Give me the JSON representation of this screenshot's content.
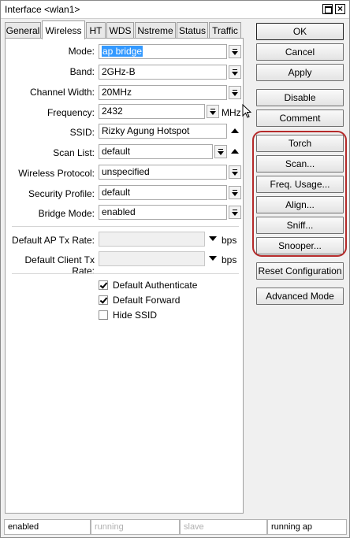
{
  "window": {
    "title": "Interface <wlan1>"
  },
  "tabs": [
    {
      "label": "General"
    },
    {
      "label": "Wireless"
    },
    {
      "label": "HT"
    },
    {
      "label": "WDS"
    },
    {
      "label": "Nstreme"
    },
    {
      "label": "Status"
    },
    {
      "label": "Traffic"
    }
  ],
  "active_tab": "Wireless",
  "form": {
    "mode": {
      "label": "Mode:",
      "value": "ap bridge"
    },
    "band": {
      "label": "Band:",
      "value": "2GHz-B"
    },
    "channel_width": {
      "label": "Channel Width:",
      "value": "20MHz"
    },
    "frequency": {
      "label": "Frequency:",
      "value": "2432",
      "unit": "MHz"
    },
    "ssid": {
      "label": "SSID:",
      "value": "Rizky Agung Hotspot"
    },
    "scan_list": {
      "label": "Scan List:",
      "value": "default"
    },
    "wireless_protocol": {
      "label": "Wireless Protocol:",
      "value": "unspecified"
    },
    "security_profile": {
      "label": "Security Profile:",
      "value": "default"
    },
    "bridge_mode": {
      "label": "Bridge Mode:",
      "value": "enabled"
    },
    "default_ap_tx_rate": {
      "label": "Default AP Tx Rate:",
      "value": "",
      "unit": "bps"
    },
    "default_client_tx_rate": {
      "label": "Default Client Tx Rate:",
      "value": "",
      "unit": "bps"
    }
  },
  "checkboxes": [
    {
      "label": "Default Authenticate",
      "checked": true
    },
    {
      "label": "Default Forward",
      "checked": true
    },
    {
      "label": "Hide SSID",
      "checked": false
    }
  ],
  "buttons": {
    "ok": "OK",
    "cancel": "Cancel",
    "apply": "Apply",
    "disable": "Disable",
    "comment": "Comment",
    "torch": "Torch",
    "scan": "Scan...",
    "freq_usage": "Freq. Usage...",
    "align": "Align...",
    "sniff": "Sniff...",
    "snooper": "Snooper...",
    "reset_configuration": "Reset Configuration",
    "advanced_mode": "Advanced Mode"
  },
  "status_bar": [
    {
      "text": "enabled",
      "dim": false
    },
    {
      "text": "running",
      "dim": true
    },
    {
      "text": "slave",
      "dim": true
    },
    {
      "text": "running ap",
      "dim": false
    }
  ],
  "colors": {
    "highlight_outline": "#b52a2a",
    "selection": "#3399ff"
  }
}
